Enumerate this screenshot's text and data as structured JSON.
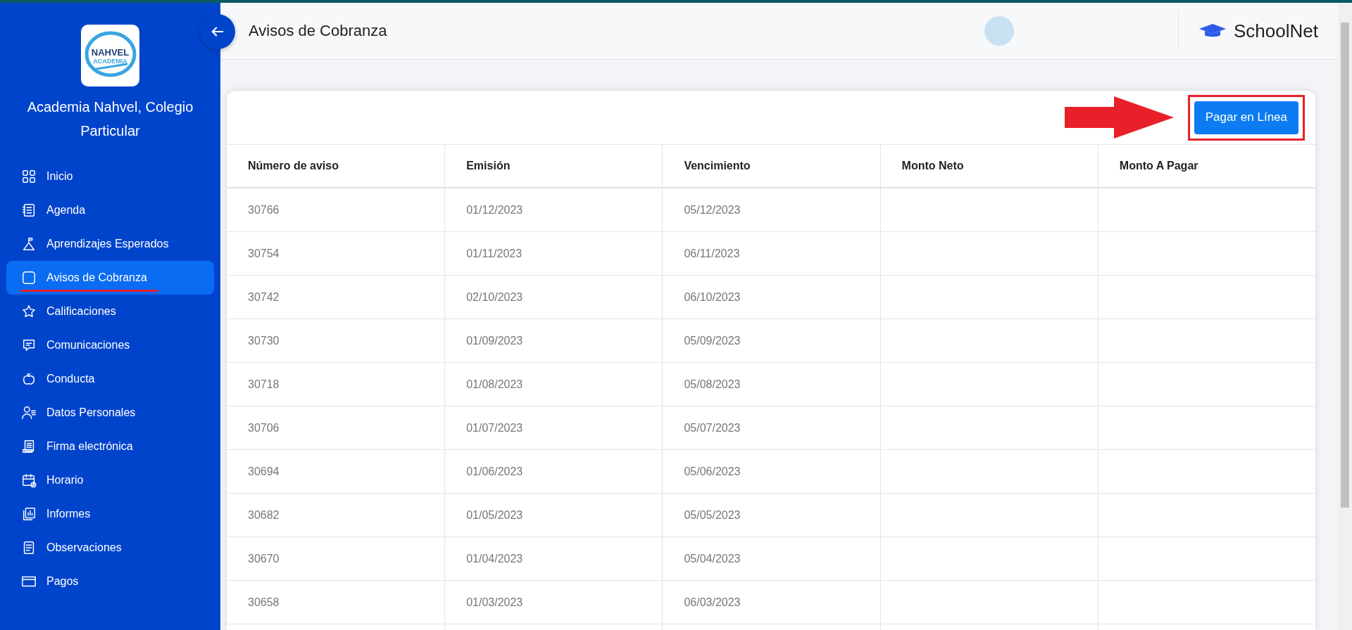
{
  "sidebar": {
    "logo": {
      "title": "NAHVEL",
      "subtitle": "ACADEMIA"
    },
    "school_name": "Academia Nahvel, Colegio Particular",
    "items": [
      {
        "label": "Inicio",
        "selected": false
      },
      {
        "label": "Agenda",
        "selected": false
      },
      {
        "label": "Aprendizajes Esperados",
        "selected": false
      },
      {
        "label": "Avisos de Cobranza",
        "selected": true
      },
      {
        "label": "Calificaciones",
        "selected": false
      },
      {
        "label": "Comunicaciones",
        "selected": false
      },
      {
        "label": "Conducta",
        "selected": false
      },
      {
        "label": "Datos Personales",
        "selected": false
      },
      {
        "label": "Firma electrónica",
        "selected": false
      },
      {
        "label": "Horario",
        "selected": false
      },
      {
        "label": "Informes",
        "selected": false
      },
      {
        "label": "Observaciones",
        "selected": false
      },
      {
        "label": "Pagos",
        "selected": false
      }
    ]
  },
  "header": {
    "title": "Avisos de Cobranza",
    "brand": "SchoolNet"
  },
  "toolbar": {
    "button": "Pagar en Línea"
  },
  "table": {
    "columns": [
      "Número de aviso",
      "Emisión",
      "Vencimiento",
      "Monto Neto",
      "Monto A Pagar"
    ],
    "rows": [
      [
        "30766",
        "01/12/2023",
        "05/12/2023"
      ],
      [
        "30754",
        "01/11/2023",
        "06/11/2023"
      ],
      [
        "30742",
        "02/10/2023",
        "06/10/2023"
      ],
      [
        "30730",
        "01/09/2023",
        "05/09/2023"
      ],
      [
        "30718",
        "01/08/2023",
        "05/08/2023"
      ],
      [
        "30706",
        "01/07/2023",
        "05/07/2023"
      ],
      [
        "30694",
        "01/06/2023",
        "05/06/2023"
      ],
      [
        "30682",
        "01/05/2023",
        "05/05/2023"
      ],
      [
        "30670",
        "01/04/2023",
        "05/04/2023"
      ],
      [
        "30658",
        "01/03/2023",
        "06/03/2023"
      ]
    ]
  }
}
